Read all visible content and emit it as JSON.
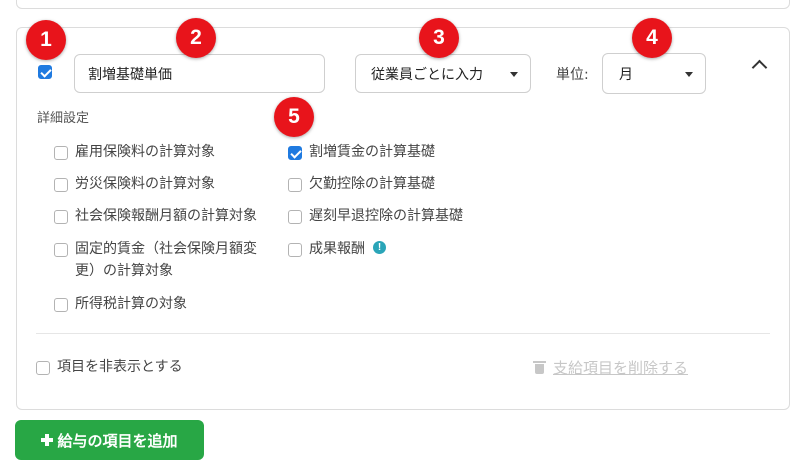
{
  "badges": [
    "1",
    "2",
    "3",
    "4",
    "5"
  ],
  "item": {
    "enabled": true,
    "name_value": "割増基礎単価",
    "input_type": "従業員ごとに入力",
    "unit_label": "単位:",
    "unit_value": "月"
  },
  "details": {
    "heading": "詳細設定",
    "left_options": [
      {
        "label": "雇用保険料の計算対象",
        "checked": false
      },
      {
        "label": "労災保険料の計算対象",
        "checked": false
      },
      {
        "label": "社会保険報酬月額の計算対象",
        "checked": false
      },
      {
        "label_line1": "固定的賃金（社会保険月額変",
        "label_line2": "更）の計算対象",
        "checked": false
      },
      {
        "label": "所得税計算の対象",
        "checked": false
      }
    ],
    "right_options": [
      {
        "label": "割増賃金の計算基礎",
        "checked": true
      },
      {
        "label": "欠勤控除の計算基礎",
        "checked": false
      },
      {
        "label": "遅刻早退控除の計算基礎",
        "checked": false
      },
      {
        "label": "成果報酬",
        "checked": false,
        "info_icon": "!"
      }
    ]
  },
  "footer": {
    "hide_label": "項目を非表示とする",
    "delete_label": "支給項目を削除する"
  },
  "add_button": {
    "label": "給与の項目を追加"
  },
  "colors": {
    "badge": "#e8141b",
    "checkbox_checked": "#1f7ae0",
    "add_button": "#28a745",
    "info": "#2aa5b8",
    "disabled_link": "#c7c7c7"
  }
}
